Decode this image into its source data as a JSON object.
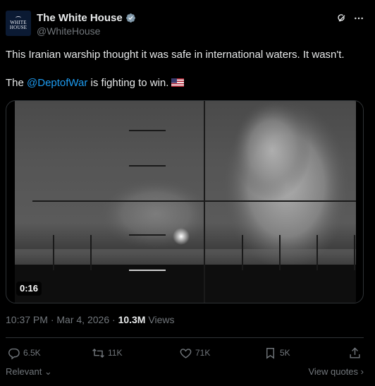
{
  "author": {
    "name": "The White House",
    "handle": "@WhiteHouse",
    "avatar_text_line1": "WHITE",
    "avatar_text_line2": "HOUSE",
    "verified": true
  },
  "tweet": {
    "line1": "This Iranian warship thought it was safe in international waters. It wasn't.",
    "line2_prefix": "The ",
    "mention": "@DeptofWar",
    "line2_suffix": " is fighting to win.",
    "flag_icon": "us-flag-emoji"
  },
  "media": {
    "type": "video",
    "duration": "0:16"
  },
  "meta": {
    "time": "10:37 PM",
    "sep1": "·",
    "date": "Mar 4, 2026",
    "sep2": "·",
    "views_count": "10.3M",
    "views_label": "Views"
  },
  "actions": {
    "replies": "6.5K",
    "reposts": "11K",
    "likes": "71K",
    "bookmarks": "5K"
  },
  "sort": {
    "relevant_label": "Relevant",
    "view_quotes_label": "View quotes"
  },
  "colors": {
    "background": "#000000",
    "text": "#e7e9ea",
    "muted": "#71767b",
    "link": "#1d9bf0",
    "border": "#2f3336",
    "verified": "#829aab"
  }
}
